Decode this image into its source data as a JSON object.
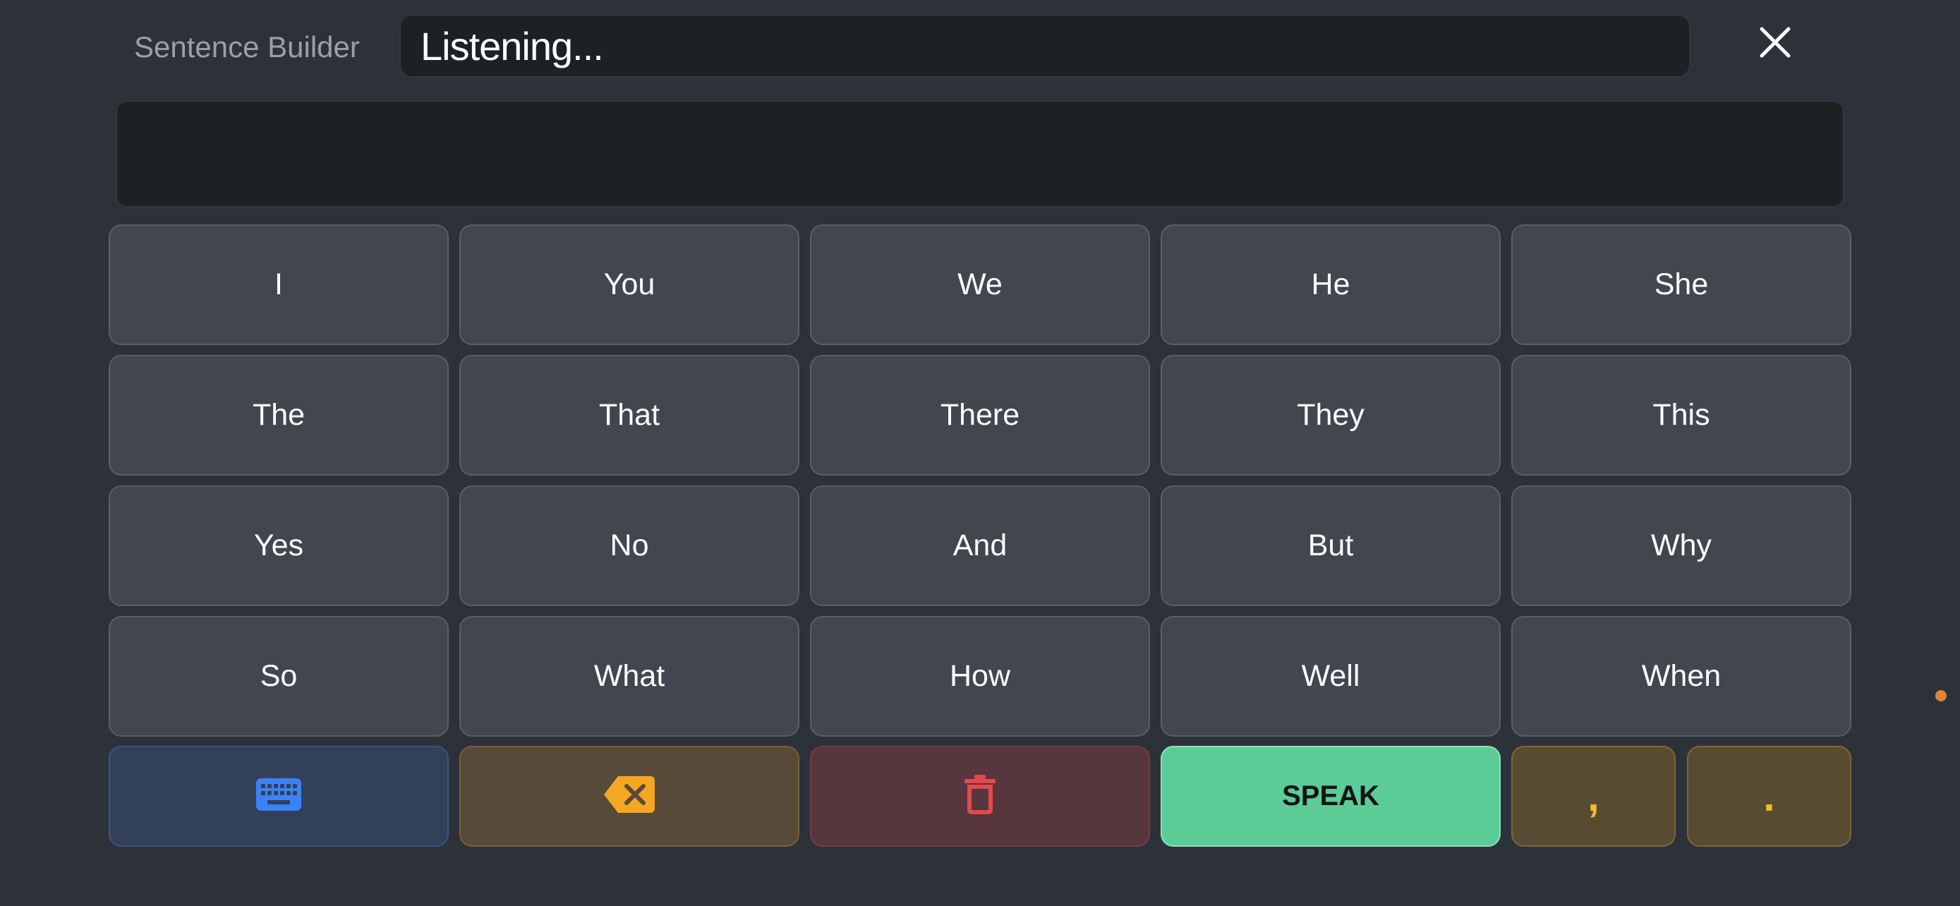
{
  "header": {
    "app_title": "Sentence Builder",
    "status_text": "Listening...",
    "close_icon": "close-icon"
  },
  "sentence": {
    "text": ""
  },
  "words": [
    [
      "I",
      "You",
      "We",
      "He",
      "She"
    ],
    [
      "The",
      "That",
      "There",
      "They",
      "This"
    ],
    [
      "Yes",
      "No",
      "And",
      "But",
      "Why"
    ],
    [
      "So",
      "What",
      "How",
      "Well",
      "When"
    ]
  ],
  "actions": {
    "keyboard_icon": "keyboard-icon",
    "backspace_icon": "backspace-icon",
    "clear_icon": "trash-icon",
    "speak_label": "SPEAK",
    "comma_label": ",",
    "period_label": "."
  },
  "colors": {
    "background": "#2d323a",
    "word_button": "#42464f",
    "keyboard": "#3b82f6",
    "backspace": "#f5a623",
    "clear": "#e5484d",
    "speak": "#5ccc97",
    "punctuation": "#f2b82e"
  }
}
